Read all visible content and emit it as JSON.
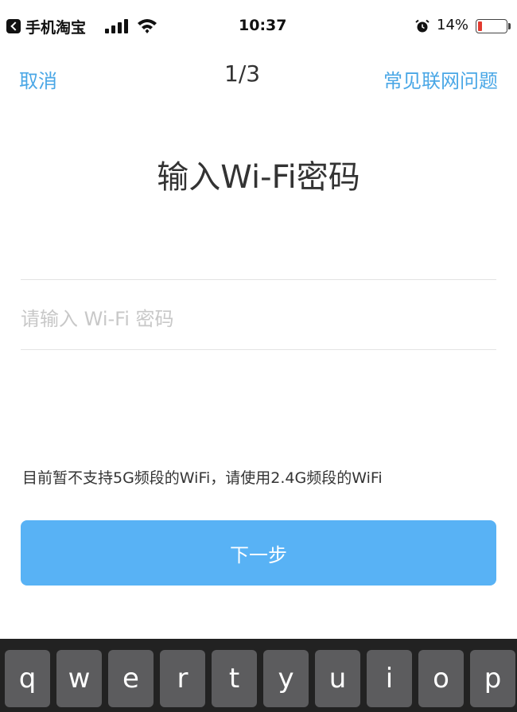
{
  "status_bar": {
    "app_name": "手机淘宝",
    "time": "10:37",
    "battery_percent": "14%",
    "battery_level": 0.14,
    "icons": [
      "back-arrow-icon",
      "signal-icon",
      "wifi-icon",
      "alarm-icon",
      "battery-icon"
    ]
  },
  "nav": {
    "cancel_label": "取消",
    "step": "1/3",
    "help_label": "常见联网问题"
  },
  "main": {
    "title": "输入Wi-Fi密码",
    "ssid_value": "",
    "password_placeholder": "请输入 Wi-Fi 密码",
    "note": "目前暂不支持5G频段的WiFi，请使用2.4G频段的WiFi",
    "next_label": "下一步"
  },
  "keyboard": {
    "keys": [
      "q",
      "w",
      "e",
      "r",
      "t",
      "y",
      "u",
      "i",
      "o",
      "p"
    ]
  },
  "colors": {
    "accent": "#4aa7e6",
    "button": "#58b2f5",
    "battery_low": "#e23a2f",
    "keyboard_bg": "#222222",
    "key_bg": "#5c5c5e"
  }
}
